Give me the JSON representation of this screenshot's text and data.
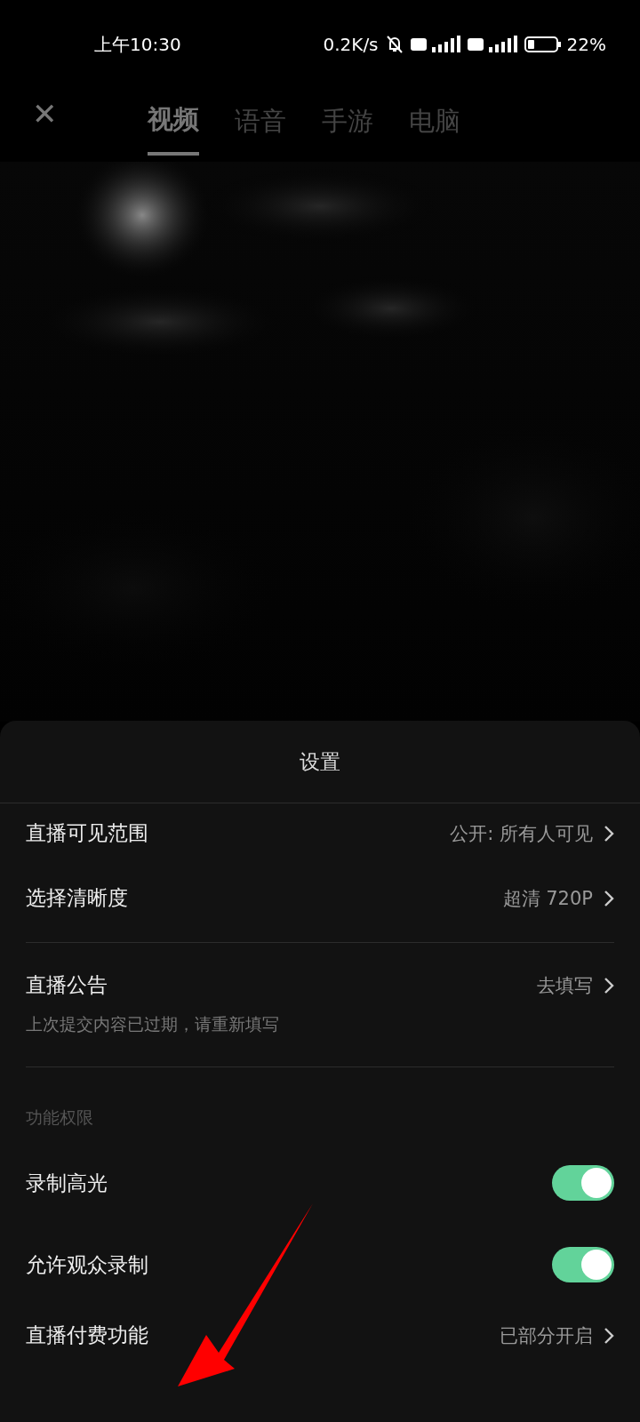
{
  "status_bar": {
    "time": "上午10:30",
    "speed": "0.2K/s",
    "battery": "22%"
  },
  "close": "✕",
  "tabs": [
    {
      "label": "视频",
      "selected": true
    },
    {
      "label": "语音",
      "selected": false
    },
    {
      "label": "手游",
      "selected": false
    },
    {
      "label": "电脑",
      "selected": false
    }
  ],
  "sheet": {
    "title": "设置",
    "rows": [
      {
        "kind": "link",
        "label": "直播可见范围",
        "value": "公开: 所有人可见"
      },
      {
        "kind": "link",
        "label": "选择清晰度",
        "value": "超清 720P"
      },
      {
        "kind": "divider"
      },
      {
        "kind": "link",
        "label": "直播公告",
        "value": "去填写",
        "note": "上次提交内容已过期，请重新填写"
      },
      {
        "kind": "divider"
      },
      {
        "kind": "section",
        "label": "功能权限"
      },
      {
        "kind": "toggle",
        "label": "录制高光",
        "on": true
      },
      {
        "kind": "toggle",
        "label": "允许观众录制",
        "on": true
      },
      {
        "kind": "link",
        "label": "直播付费功能",
        "value": "已部分开启"
      }
    ]
  }
}
